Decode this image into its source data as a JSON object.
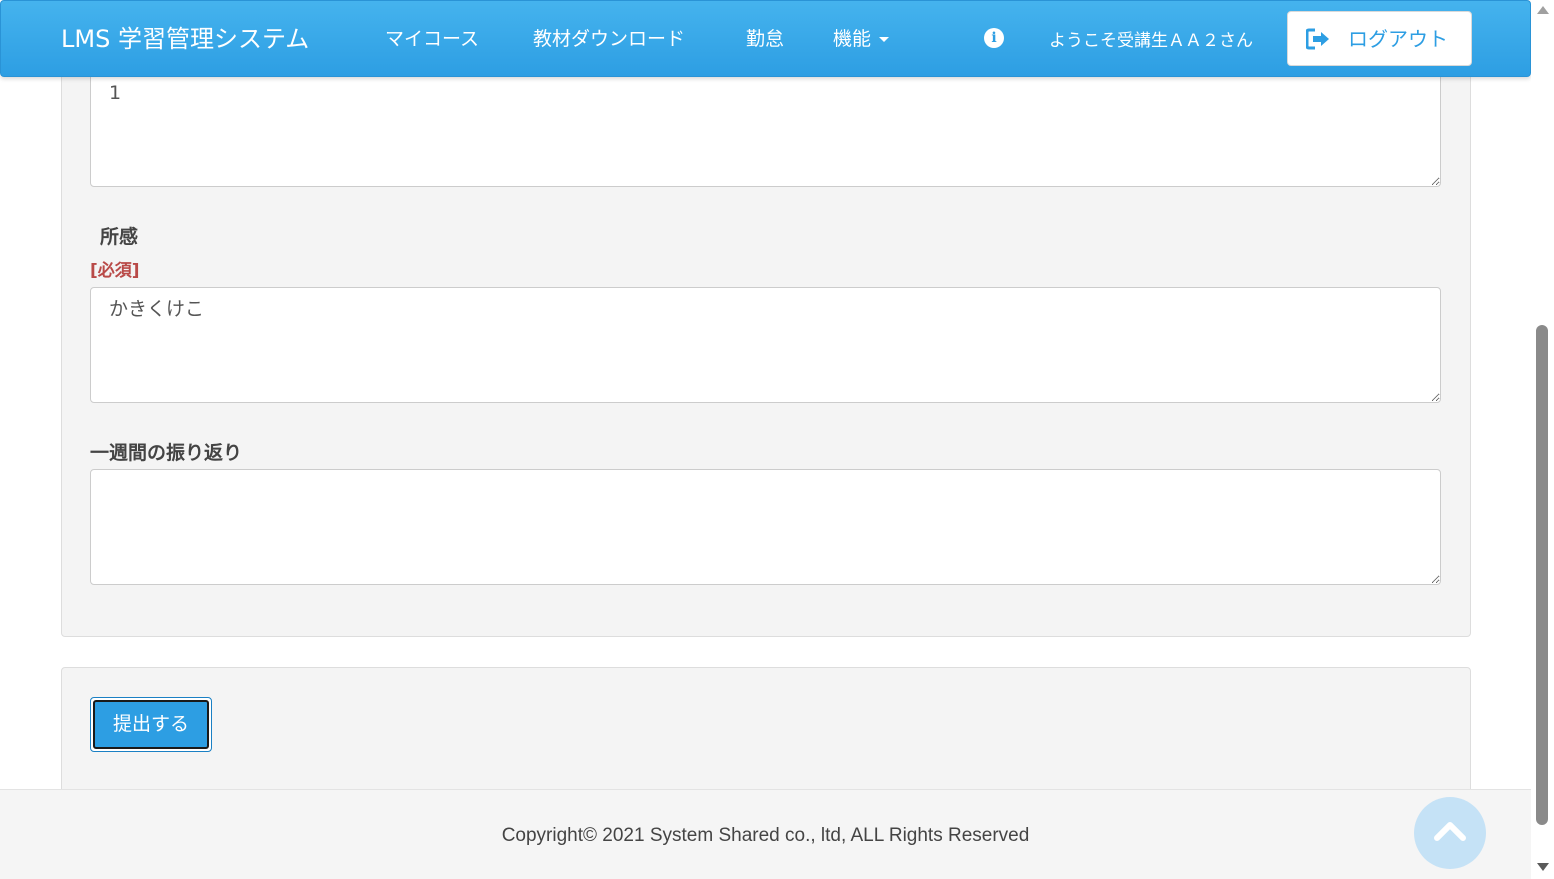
{
  "navbar": {
    "brand": "LMS 学習管理システム",
    "items": [
      {
        "label": "マイコース"
      },
      {
        "label": "教材ダウンロード"
      },
      {
        "label": "勤怠"
      },
      {
        "label": "機能"
      }
    ],
    "info_icon_glyph": "i",
    "welcome": "ようこそ受講生ＡＡ２さん",
    "logout_label": "ログアウト",
    "accent_color": "#2d9ee3"
  },
  "form": {
    "field1_value": "1",
    "shokan_label": "所感",
    "required_label": "[必須]",
    "shokan_value": "かきくけこ",
    "review_label": "一週間の振り返り",
    "review_value": ""
  },
  "submit": {
    "label": "提出する"
  },
  "footer": {
    "copyright": "Copyright© 2021 System Shared co., ltd, ALL Rights Reserved"
  },
  "icons": {
    "info": "info-icon",
    "logout": "logout-icon",
    "scroll_top": "chevron-up-icon",
    "dropdown": "caret-down-icon"
  },
  "colors": {
    "required": "#b94a48",
    "panel_bg": "#f4f4f4"
  }
}
